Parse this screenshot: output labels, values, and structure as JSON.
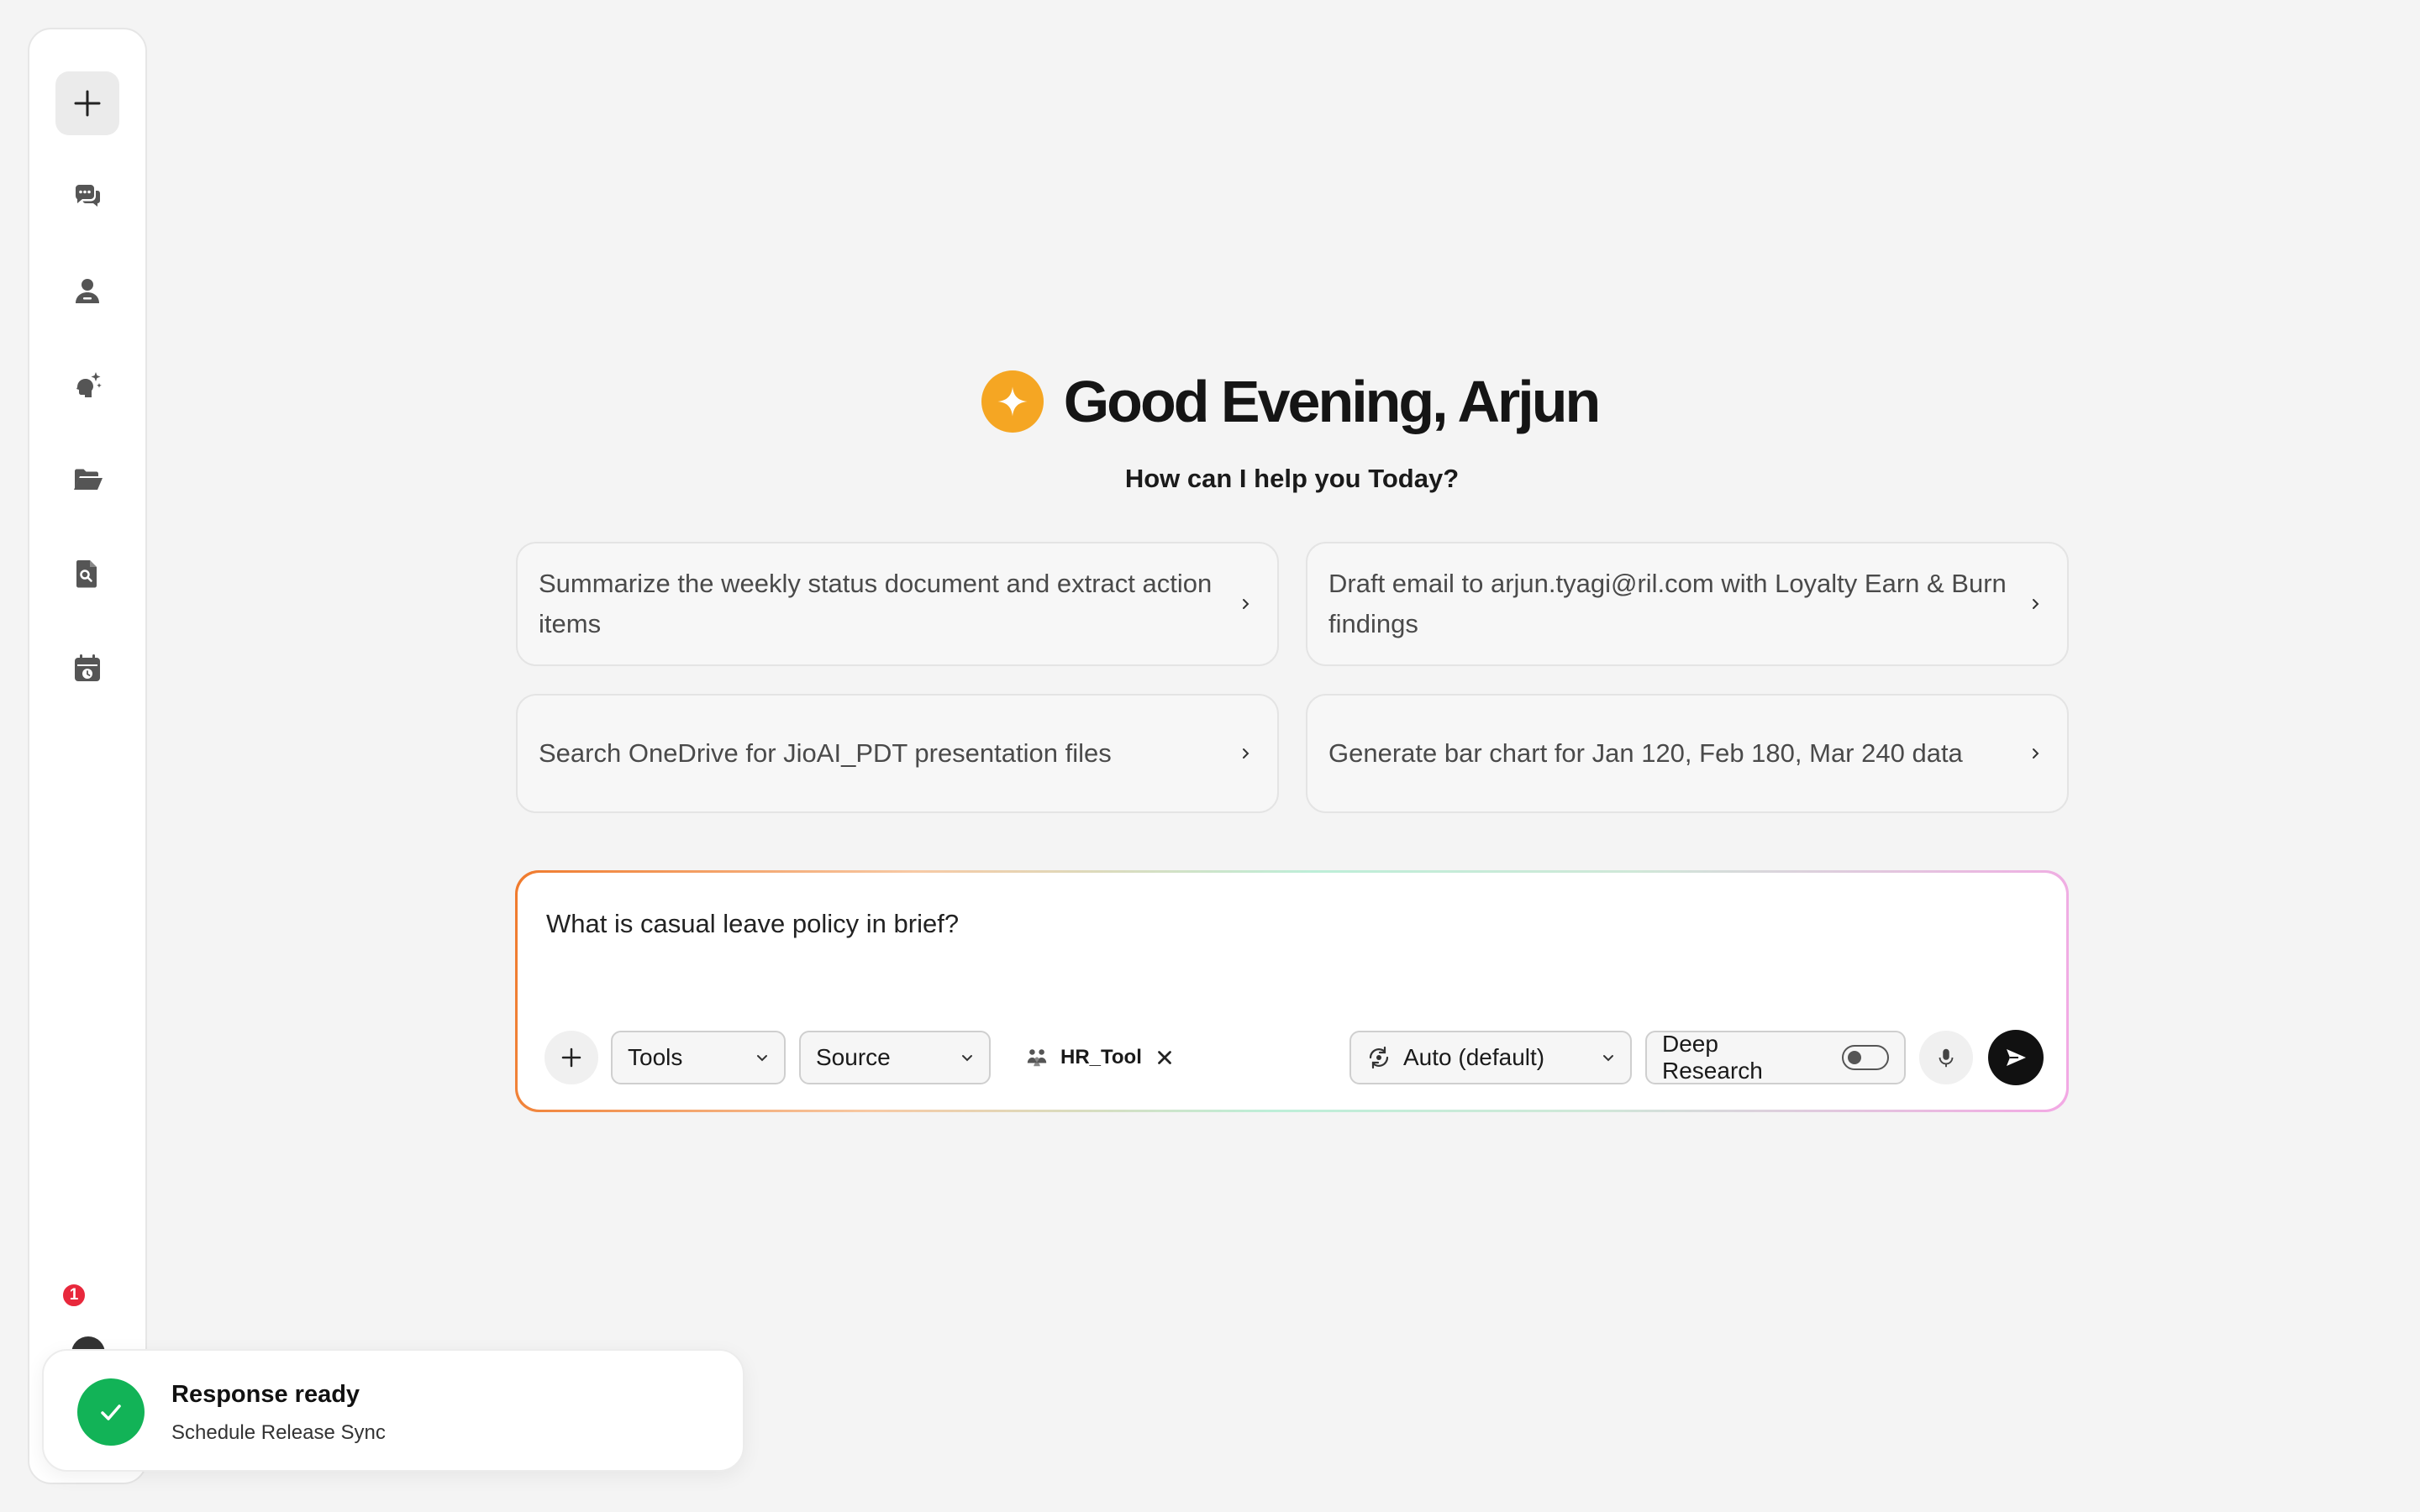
{
  "sidebar": {
    "items": [
      {
        "icon": "plus-icon",
        "label": "New chat",
        "active": true
      },
      {
        "icon": "chat-bubbles-icon",
        "label": "Chats"
      },
      {
        "icon": "user-icon",
        "label": "Profile"
      },
      {
        "icon": "brain-sparkle-icon",
        "label": "AI tools"
      },
      {
        "icon": "folder-icon",
        "label": "Files"
      },
      {
        "icon": "document-search-icon",
        "label": "Document search"
      },
      {
        "icon": "calendar-clock-icon",
        "label": "Schedule"
      }
    ],
    "notification_count": "1"
  },
  "greeting": {
    "title": "Good Evening, Arjun",
    "subtitle": "How can I help you Today?",
    "logo_color": "#f5a623"
  },
  "suggestions": [
    {
      "text": "Summarize the weekly status document and extract action items"
    },
    {
      "text": "Draft email to arjun.tyagi@ril.com with Loyalty Earn & Burn findings"
    },
    {
      "text": "Search OneDrive for JioAI_PDT presentation files"
    },
    {
      "text": "Generate bar chart for Jan 120, Feb 180, Mar 240 data"
    }
  ],
  "prompt": {
    "value": "What is casual leave policy in brief?",
    "tools_label": "Tools",
    "source_label": "Source",
    "chip_label": "HR_Tool",
    "model_label": "Auto (default)",
    "deep_research_label": "Deep Research",
    "deep_research_enabled": false
  },
  "toast": {
    "title": "Response ready",
    "subtitle": "Schedule Release Sync",
    "accent": "#12b357"
  }
}
